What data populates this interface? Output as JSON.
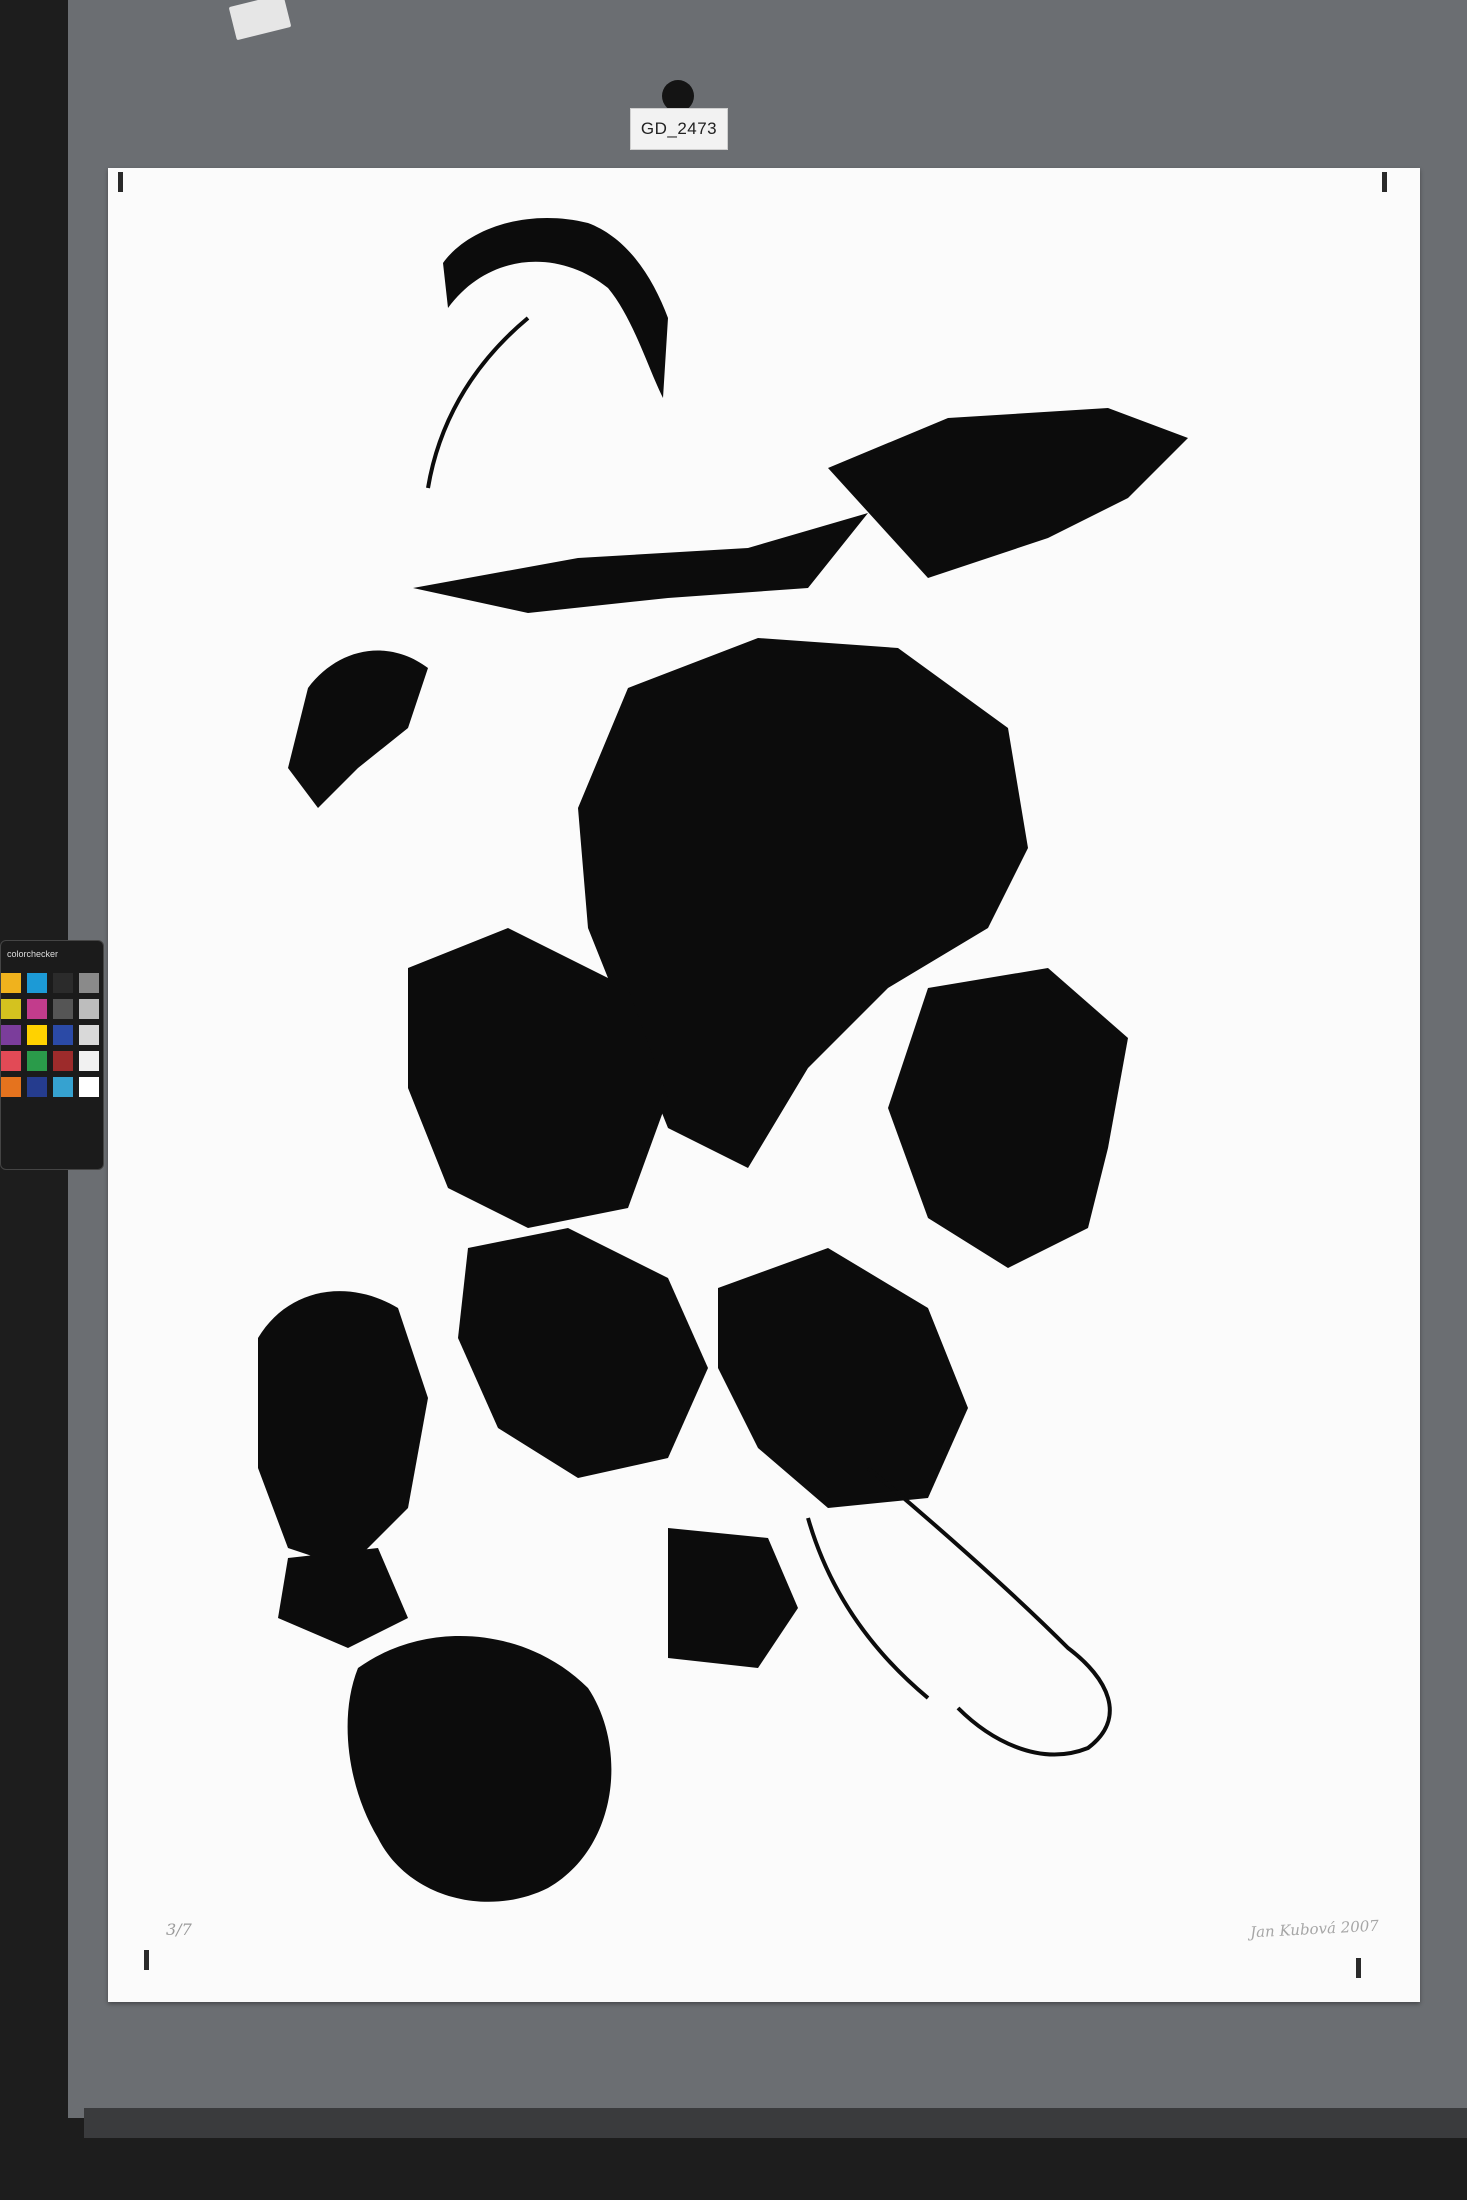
{
  "label": {
    "catalog_id": "GD_2473"
  },
  "corner_tag": {
    "text": ""
  },
  "artwork": {
    "edition": "3/7",
    "signature": "Jan Kubová 2007"
  },
  "color_checker": {
    "brand": "colorchecker",
    "patches": [
      "#f0b21d",
      "#1c9ad6",
      "#2b2b2b",
      "#8a8a8a",
      "#d4c21f",
      "#c23c8c",
      "#555555",
      "#bdbdbd",
      "#7b3d9b",
      "#ffd200",
      "#2b4aa6",
      "#d9d9d9",
      "#e24a56",
      "#2a9b4a",
      "#9d2b2b",
      "#f1f1f1",
      "#e5731e",
      "#253c8e",
      "#36a2d0",
      "#ffffff"
    ]
  }
}
